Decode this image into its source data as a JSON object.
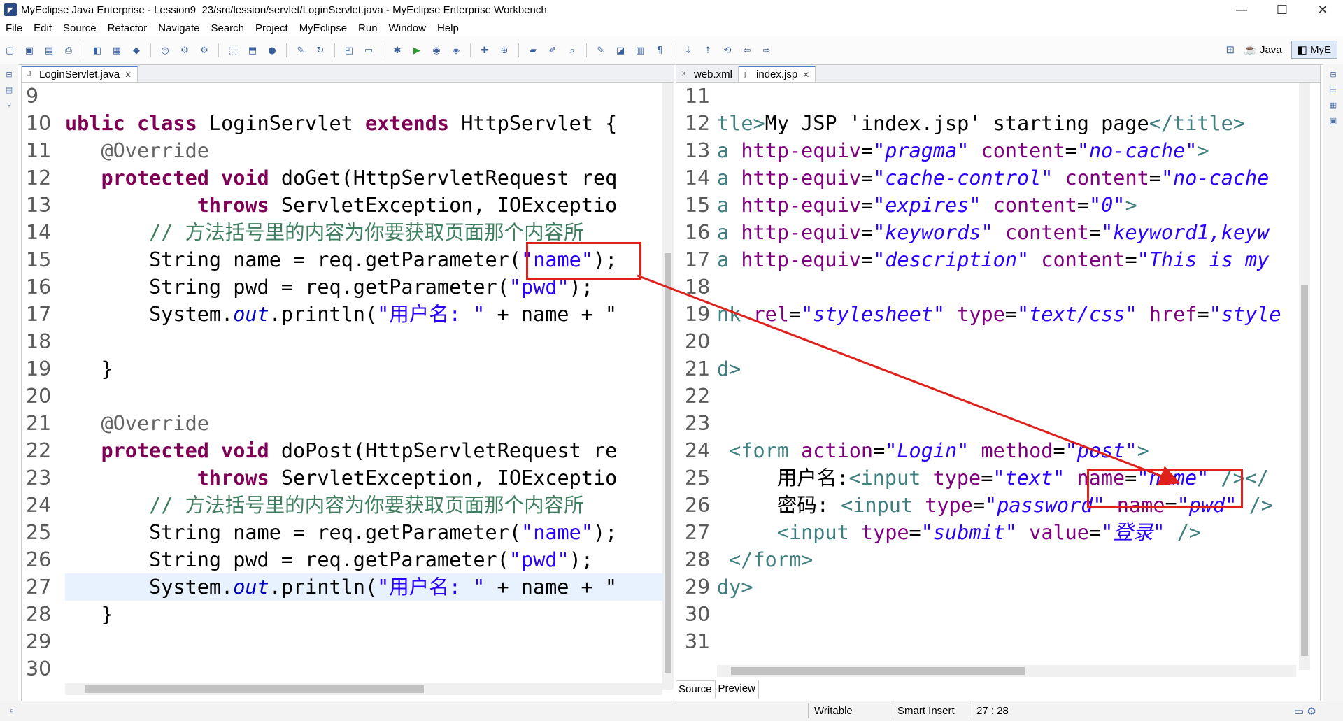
{
  "window": {
    "title": "MyEclipse Java Enterprise - Lession9_23/src/lession/servlet/LoginServlet.java - MyEclipse Enterprise Workbench",
    "minimize": "—",
    "maximize": "☐",
    "close": "✕"
  },
  "menu": [
    "File",
    "Edit",
    "Source",
    "Refactor",
    "Navigate",
    "Search",
    "Project",
    "MyEclipse",
    "Run",
    "Window",
    "Help"
  ],
  "perspectives": {
    "java": "Java",
    "myeclipse": "MyE"
  },
  "left_editor": {
    "tab": "LoginServlet.java",
    "line_numbers": [
      "9",
      "10",
      "11",
      "12",
      "13",
      "14",
      "15",
      "16",
      "17",
      "18",
      "19",
      "20",
      "21",
      "22",
      "23",
      "24",
      "25",
      "26",
      "27",
      "28",
      "29",
      "30"
    ],
    "lines": [
      [],
      [
        {
          "c": "kw",
          "t": "ublic class "
        },
        {
          "c": "",
          "t": "LoginServlet "
        },
        {
          "c": "kw",
          "t": "extends "
        },
        {
          "c": "",
          "t": "HttpServlet {"
        }
      ],
      [
        {
          "c": "ann",
          "t": "   @Override"
        }
      ],
      [
        {
          "c": "kw",
          "t": "   protected void "
        },
        {
          "c": "",
          "t": "doGet(HttpServletRequest req"
        }
      ],
      [
        {
          "c": "kw",
          "t": "           throws "
        },
        {
          "c": "",
          "t": "ServletException, IOExceptio"
        }
      ],
      [
        {
          "c": "cmt",
          "t": "       // 方法括号里的内容为你要获取页面那个内容所"
        }
      ],
      [
        {
          "c": "",
          "t": "       String name = req.getParameter("
        },
        {
          "c": "str",
          "t": "\"name\""
        },
        {
          "c": "",
          "t": ");"
        }
      ],
      [
        {
          "c": "",
          "t": "       String pwd = req.getParameter("
        },
        {
          "c": "str",
          "t": "\"pwd\""
        },
        {
          "c": "",
          "t": ");"
        }
      ],
      [
        {
          "c": "",
          "t": "       System."
        },
        {
          "c": "ital",
          "t": "out"
        },
        {
          "c": "",
          "t": ".println("
        },
        {
          "c": "str",
          "t": "\"用户名: \""
        },
        {
          "c": "",
          "t": " + name + \""
        }
      ],
      [],
      [
        {
          "c": "",
          "t": "   }"
        }
      ],
      [],
      [
        {
          "c": "ann",
          "t": "   @Override"
        }
      ],
      [
        {
          "c": "kw",
          "t": "   protected void "
        },
        {
          "c": "",
          "t": "doPost(HttpServletRequest re"
        }
      ],
      [
        {
          "c": "kw",
          "t": "           throws "
        },
        {
          "c": "",
          "t": "ServletException, IOExceptio"
        }
      ],
      [
        {
          "c": "cmt",
          "t": "       // 方法括号里的内容为你要获取页面那个内容所"
        }
      ],
      [
        {
          "c": "",
          "t": "       String name = req.getParameter("
        },
        {
          "c": "str",
          "t": "\"name\""
        },
        {
          "c": "",
          "t": ");"
        }
      ],
      [
        {
          "c": "",
          "t": "       String pwd = req.getParameter("
        },
        {
          "c": "str",
          "t": "\"pwd\""
        },
        {
          "c": "",
          "t": ");"
        }
      ],
      [
        {
          "c": "",
          "t": "       System."
        },
        {
          "c": "ital",
          "t": "out"
        },
        {
          "c": "",
          "t": ".println("
        },
        {
          "c": "str",
          "t": "\"用户名: \""
        },
        {
          "c": "",
          "t": " + name + \""
        }
      ],
      [
        {
          "c": "",
          "t": "   }"
        }
      ],
      [],
      []
    ],
    "current_line_index": 18
  },
  "right_editor": {
    "tabs": [
      "web.xml",
      "index.jsp"
    ],
    "active_tab": "index.jsp",
    "line_numbers": [
      "11",
      "12",
      "13",
      "14",
      "15",
      "16",
      "17",
      "18",
      "19",
      "20",
      "21",
      "22",
      "23",
      "24",
      "25",
      "26",
      "27",
      "28",
      "29",
      "30",
      "31"
    ],
    "lines": [
      [],
      [
        {
          "c": "tag",
          "t": "tle>"
        },
        {
          "c": "",
          "t": "My JSP 'index.jsp' starting page"
        },
        {
          "c": "tag",
          "t": "</title>"
        }
      ],
      [
        {
          "c": "tag",
          "t": "a "
        },
        {
          "c": "attr",
          "t": "http-equiv"
        },
        {
          "c": "",
          "t": "="
        },
        {
          "c": "aval",
          "t": "\"pragma\""
        },
        {
          "c": "",
          "t": " "
        },
        {
          "c": "attr",
          "t": "content"
        },
        {
          "c": "",
          "t": "="
        },
        {
          "c": "aval",
          "t": "\"no-cache\""
        },
        {
          "c": "tag",
          "t": ">"
        }
      ],
      [
        {
          "c": "tag",
          "t": "a "
        },
        {
          "c": "attr",
          "t": "http-equiv"
        },
        {
          "c": "",
          "t": "="
        },
        {
          "c": "aval",
          "t": "\"cache-control\""
        },
        {
          "c": "",
          "t": " "
        },
        {
          "c": "attr",
          "t": "content"
        },
        {
          "c": "",
          "t": "="
        },
        {
          "c": "aval",
          "t": "\"no-cache"
        }
      ],
      [
        {
          "c": "tag",
          "t": "a "
        },
        {
          "c": "attr",
          "t": "http-equiv"
        },
        {
          "c": "",
          "t": "="
        },
        {
          "c": "aval",
          "t": "\"expires\""
        },
        {
          "c": "",
          "t": " "
        },
        {
          "c": "attr",
          "t": "content"
        },
        {
          "c": "",
          "t": "="
        },
        {
          "c": "aval",
          "t": "\"0\""
        },
        {
          "c": "tag",
          "t": ">"
        }
      ],
      [
        {
          "c": "tag",
          "t": "a "
        },
        {
          "c": "attr",
          "t": "http-equiv"
        },
        {
          "c": "",
          "t": "="
        },
        {
          "c": "aval",
          "t": "\"keywords\""
        },
        {
          "c": "",
          "t": " "
        },
        {
          "c": "attr",
          "t": "content"
        },
        {
          "c": "",
          "t": "="
        },
        {
          "c": "aval",
          "t": "\"keyword1,keyw"
        }
      ],
      [
        {
          "c": "tag",
          "t": "a "
        },
        {
          "c": "attr",
          "t": "http-equiv"
        },
        {
          "c": "",
          "t": "="
        },
        {
          "c": "aval",
          "t": "\"description\""
        },
        {
          "c": "",
          "t": " "
        },
        {
          "c": "attr",
          "t": "content"
        },
        {
          "c": "",
          "t": "="
        },
        {
          "c": "aval",
          "t": "\"This is my"
        }
      ],
      [],
      [
        {
          "c": "tag",
          "t": "nk "
        },
        {
          "c": "attr",
          "t": "rel"
        },
        {
          "c": "",
          "t": "="
        },
        {
          "c": "aval",
          "t": "\"stylesheet\""
        },
        {
          "c": "",
          "t": " "
        },
        {
          "c": "attr",
          "t": "type"
        },
        {
          "c": "",
          "t": "="
        },
        {
          "c": "aval",
          "t": "\"text/css\""
        },
        {
          "c": "",
          "t": " "
        },
        {
          "c": "attr",
          "t": "href"
        },
        {
          "c": "",
          "t": "="
        },
        {
          "c": "aval",
          "t": "\"style"
        }
      ],
      [],
      [
        {
          "c": "tag",
          "t": "d>"
        }
      ],
      [],
      [],
      [
        {
          "c": "tag",
          "t": " <form "
        },
        {
          "c": "attr",
          "t": "action"
        },
        {
          "c": "",
          "t": "="
        },
        {
          "c": "aval",
          "t": "\"Login\""
        },
        {
          "c": "",
          "t": " "
        },
        {
          "c": "attr",
          "t": "method"
        },
        {
          "c": "",
          "t": "="
        },
        {
          "c": "aval",
          "t": "\"post\""
        },
        {
          "c": "tag",
          "t": ">"
        }
      ],
      [
        {
          "c": "",
          "t": "     用户名:"
        },
        {
          "c": "tag",
          "t": "<input "
        },
        {
          "c": "attr",
          "t": "type"
        },
        {
          "c": "",
          "t": "="
        },
        {
          "c": "aval",
          "t": "\"text\""
        },
        {
          "c": "",
          "t": " "
        },
        {
          "c": "attr",
          "t": "name"
        },
        {
          "c": "",
          "t": "="
        },
        {
          "c": "aval",
          "t": "\"name\""
        },
        {
          "c": "",
          "t": " "
        },
        {
          "c": "tag",
          "t": "/></"
        }
      ],
      [
        {
          "c": "",
          "t": "     密码: "
        },
        {
          "c": "tag",
          "t": "<input "
        },
        {
          "c": "attr",
          "t": "type"
        },
        {
          "c": "",
          "t": "="
        },
        {
          "c": "aval",
          "t": "\"password\""
        },
        {
          "c": "",
          "t": " "
        },
        {
          "c": "attr",
          "t": "name"
        },
        {
          "c": "",
          "t": "="
        },
        {
          "c": "aval",
          "t": "\"pwd\""
        },
        {
          "c": "",
          "t": " "
        },
        {
          "c": "tag",
          "t": "/>"
        }
      ],
      [
        {
          "c": "",
          "t": "     "
        },
        {
          "c": "tag",
          "t": "<input "
        },
        {
          "c": "attr",
          "t": "type"
        },
        {
          "c": "",
          "t": "="
        },
        {
          "c": "aval",
          "t": "\"submit\""
        },
        {
          "c": "",
          "t": " "
        },
        {
          "c": "attr",
          "t": "value"
        },
        {
          "c": "",
          "t": "="
        },
        {
          "c": "aval",
          "t": "\"登录\""
        },
        {
          "c": "",
          "t": " "
        },
        {
          "c": "tag",
          "t": "/>"
        }
      ],
      [
        {
          "c": "tag",
          "t": " </form>"
        }
      ],
      [
        {
          "c": "tag",
          "t": "dy>"
        }
      ],
      [],
      []
    ],
    "bottom_tabs": [
      "Source",
      "Preview"
    ]
  },
  "status": {
    "writable": "Writable",
    "insert_mode": "Smart Insert",
    "position": "27 : 28"
  },
  "colors": {
    "highlight_box": "#e0201b",
    "arrow": "#e0201b",
    "keyword": "#7f0055",
    "string": "#2a00ff"
  }
}
